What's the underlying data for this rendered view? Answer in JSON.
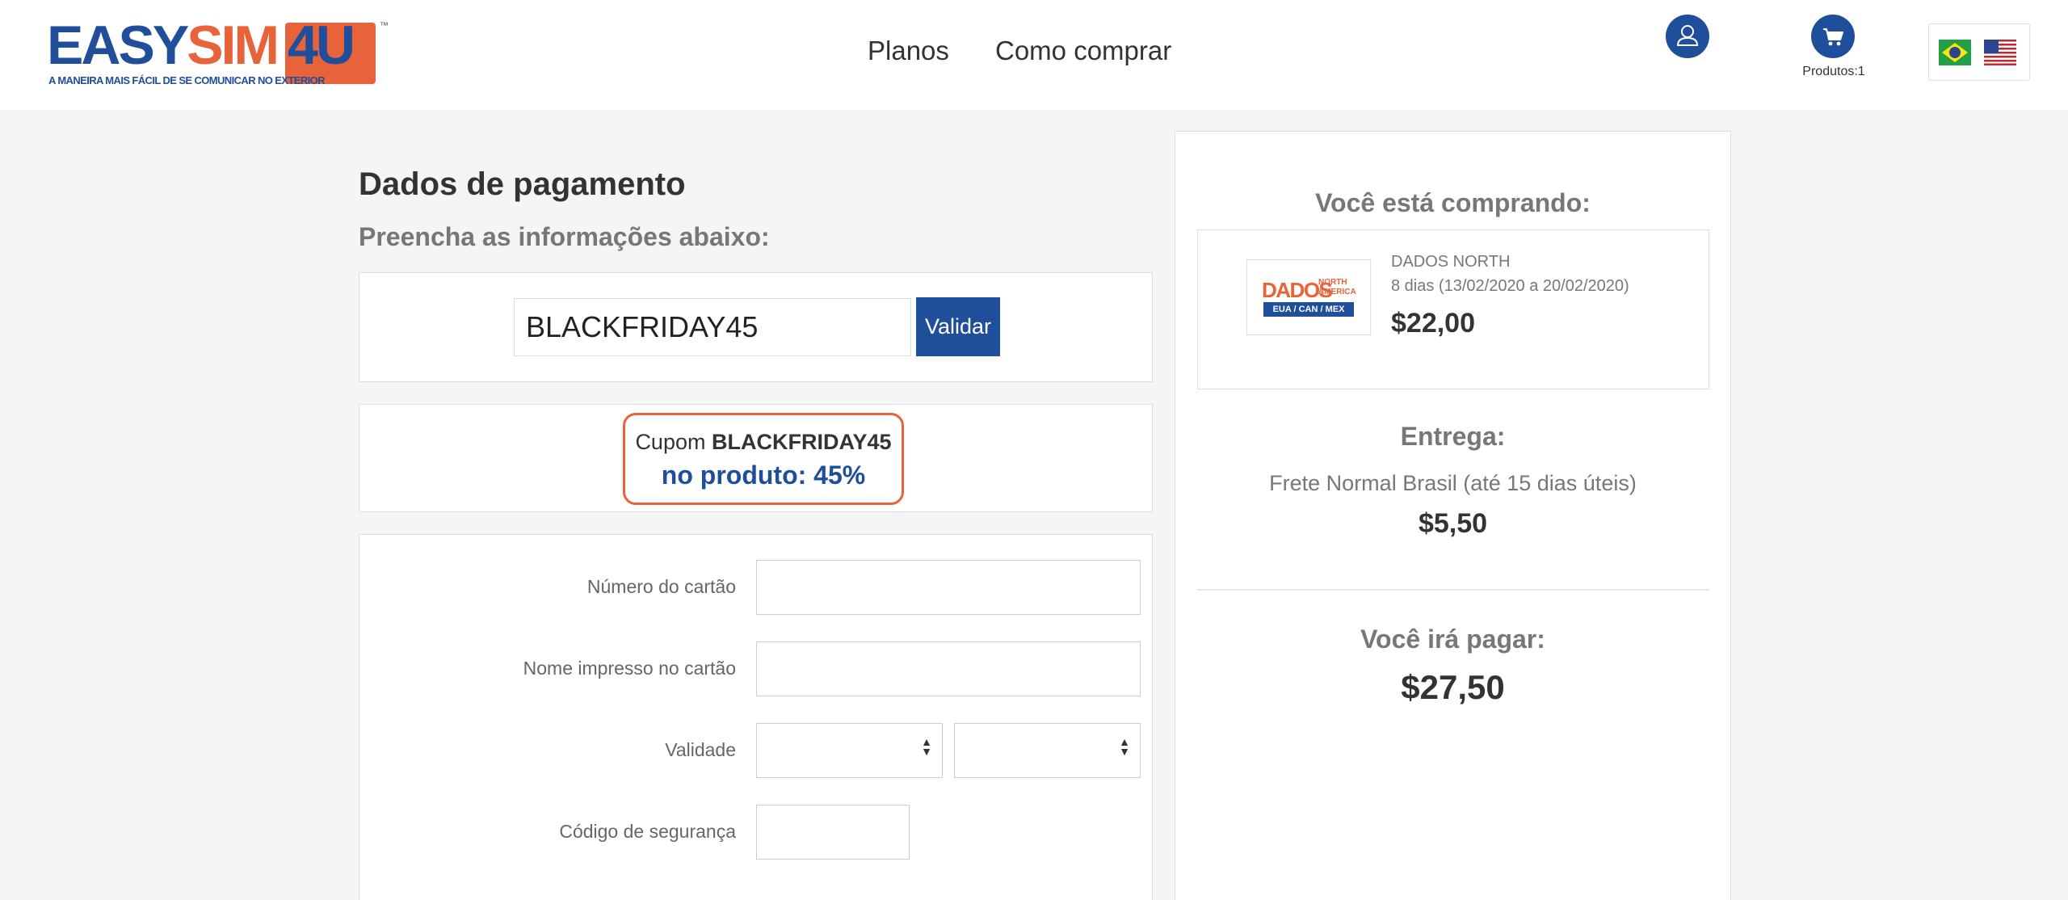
{
  "header": {
    "logo": {
      "part1": "EASY",
      "part2": "SIM",
      "part3": "4U",
      "tm": "™",
      "tagline": "A MANEIRA MAIS FÁCIL DE SE COMUNICAR NO EXTERIOR"
    },
    "nav": [
      {
        "label": "Planos"
      },
      {
        "label": "Como comprar"
      }
    ],
    "icons": {
      "user": "user-icon",
      "cart": "cart-icon",
      "flag_br": "brazil-flag-icon",
      "flag_us": "usa-flag-icon"
    },
    "cart_label": "Produtos:1"
  },
  "payment": {
    "title": "Dados de pagamento",
    "subtitle": "Preencha as informações abaixo:",
    "coupon": {
      "value": "BLACKFRIDAY45",
      "validate_label": "Validar"
    },
    "discount": {
      "prefix": "Cupom",
      "code": "BLACKFRIDAY45",
      "detail": "no produto: 45%"
    },
    "form": {
      "card_number_label": "Número do cartão",
      "card_name_label": "Nome impresso no cartão",
      "expiry_label": "Validade",
      "cvv_label": "Código de segurança"
    }
  },
  "summary": {
    "buying_heading": "Você está comprando:",
    "product": {
      "thumb_title": "DADOS",
      "thumb_region": "NORTH AMERICA",
      "thumb_countries": "EUA / CAN / MEX",
      "name": "DADOS NORTH",
      "dates": "8 dias (13/02/2020 a 20/02/2020)",
      "price": "$22,00"
    },
    "delivery_heading": "Entrega:",
    "delivery_method": "Frete Normal Brasil (até 15 dias úteis)",
    "delivery_price": "$5,50",
    "total_heading": "Você irá pagar:",
    "total_price": "$27,50"
  },
  "colors": {
    "brand_blue": "#1f4e9a",
    "brand_orange": "#e8623a"
  }
}
